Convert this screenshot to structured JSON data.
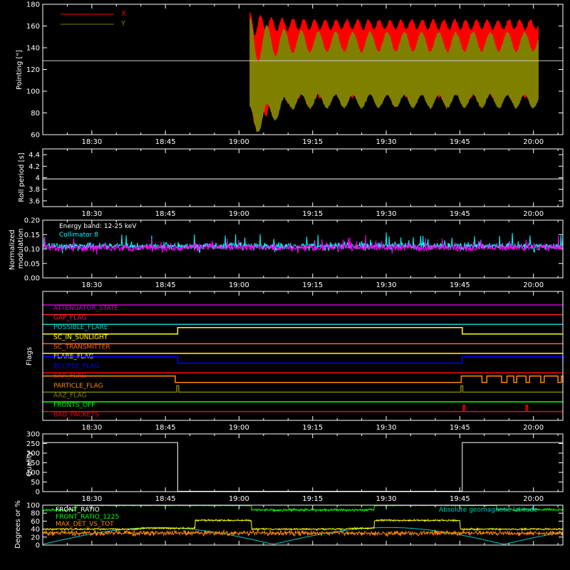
{
  "time_axis": {
    "ticks": [
      "18:30",
      "18:45",
      "19:00",
      "19:15",
      "19:30",
      "19:45",
      "20:00"
    ],
    "tick_minutes": [
      1110,
      1125,
      1140,
      1155,
      1170,
      1185,
      1200
    ],
    "range_minutes": [
      1100,
      1206
    ],
    "minor_step": 5
  },
  "chart_data": [
    {
      "type": "area",
      "id": "pointing",
      "ylabel": "Pointing [\"]",
      "ylim": [
        60,
        180
      ],
      "yticks": [
        60,
        80,
        100,
        120,
        140,
        160,
        180
      ],
      "reference_line": 128,
      "data_span_minutes": [
        1142.2,
        1201
      ],
      "series": [
        {
          "name": "X",
          "color": "#ff0000",
          "upper_mean": 161,
          "upper_amp": 4.5,
          "lower_mean": 100,
          "lower_amp": 6,
          "period_minutes": 2.2
        },
        {
          "name": "Y",
          "color": "#808000",
          "upper_mean": 145,
          "upper_amp": 9,
          "lower_mean": 91,
          "lower_amp": 6,
          "period_minutes": 3.5
        }
      ]
    },
    {
      "type": "line",
      "id": "roll",
      "ylabel": "Roll period [s]",
      "ylim": [
        3.5,
        4.5
      ],
      "yticks": [
        3.6,
        3.8,
        4.0,
        4.2,
        4.4
      ],
      "value": 3.98,
      "color": "#ffffff"
    },
    {
      "type": "line",
      "id": "modulation",
      "ylabel": "Normalized modulation",
      "ylim": [
        0,
        0.2
      ],
      "yticks": [
        "0.00",
        "0.05",
        "0.10",
        "0.15",
        "0.20"
      ],
      "annotation": "Energy band: 12-25 keV",
      "series": [
        {
          "name": "Collimator 8",
          "color": "#00ffff",
          "mean": 0.11
        },
        {
          "name": "",
          "color": "#ff00ff",
          "mean": 0.105
        }
      ]
    },
    {
      "type": "line",
      "id": "flags",
      "ylabel": "Flags",
      "flags": [
        {
          "name": "ATTENUATOR_STATE",
          "color": "#cc00cc",
          "high_spans": []
        },
        {
          "name": "GAP_FLAG",
          "color": "#ff2020",
          "high_spans": []
        },
        {
          "name": "POSSIBLE_FLARE",
          "color": "#00d0d0",
          "high_spans": []
        },
        {
          "name": "SC_IN_SUNLIGHT",
          "color": "#ffff00",
          "high_spans": [
            [
              1127.5,
              1185.5
            ]
          ]
        },
        {
          "name": "SC_TRANSMITTER",
          "color": "#ff6600",
          "high_spans": []
        },
        {
          "name": "FLARE_FLAG",
          "color": "#ffff00",
          "high_spans": []
        },
        {
          "name": "ECLIPSE_FLAG",
          "color": "#0000ff",
          "high_spans": [
            [
              1100,
              1127.5
            ],
            [
              1185.5,
              1206
            ]
          ]
        },
        {
          "name": "SAA_FLAG",
          "color": "#ff0000",
          "high_spans": []
        },
        {
          "name": "PARTICLE_FLAG",
          "color": "#ff8800",
          "high_spans": [
            [
              1100,
              1127
            ],
            [
              1185.3,
              1189.5
            ],
            [
              1190.5,
              1193.5
            ],
            [
              1194.6,
              1196
            ],
            [
              1196.6,
              1198.5
            ],
            [
              1199.2,
              1201.5
            ],
            [
              1202.2,
              1205
            ],
            [
              1205.7,
              1206
            ]
          ]
        },
        {
          "name": "AAZ_FLAG",
          "color": "#808000",
          "high_spans": [
            [
              1127.3,
              1127.7
            ],
            [
              1185.2,
              1185.6
            ]
          ]
        },
        {
          "name": "FRONTS_OFF",
          "color": "#00ff00",
          "high_spans": []
        },
        {
          "name": "BAD_PACKETS",
          "color": "#ff0000",
          "high_spans": [
            [
              1185.7,
              1186
            ],
            [
              1198.5,
              1198.8
            ]
          ]
        }
      ]
    },
    {
      "type": "line",
      "id": "quality",
      "ylabel": "Quality",
      "ylim": [
        0,
        300
      ],
      "yticks": [
        0,
        50,
        100,
        150,
        200,
        250,
        300
      ],
      "color": "#ffffff",
      "high_value": 255,
      "high_spans": [
        [
          1100,
          1127.5
        ],
        [
          1185.5,
          1206
        ]
      ]
    },
    {
      "type": "line",
      "id": "ratios",
      "ylabel": "Degrees or %",
      "ylim": [
        0,
        100
      ],
      "yticks": [
        0,
        20,
        40,
        60,
        80,
        100
      ],
      "series": [
        {
          "name": "FRONT_RATIO",
          "color": "#ffffff"
        },
        {
          "name": "FRONT_RATIO_1225",
          "color": "#00ff00",
          "levels": [
            [
              1100,
              1106.5,
              88
            ],
            [
              1106.5,
              1142.5,
              99
            ],
            [
              1142.5,
              1167.5,
              88
            ],
            [
              1167.5,
              1192.5,
              99
            ],
            [
              1192.5,
              1206,
              89
            ]
          ]
        },
        {
          "name": "MAX_DET_VS_TOT",
          "color": "#ff8800",
          "mean": 30
        },
        {
          "name": "",
          "color": "#ffff00",
          "levels": [
            [
              1100,
              1120,
              40
            ],
            [
              1120,
              1131,
              42
            ],
            [
              1131,
              1142.5,
              62
            ],
            [
              1142.5,
              1162,
              40
            ],
            [
              1162,
              1167.5,
              42
            ],
            [
              1167.5,
              1185,
              62
            ],
            [
              1185,
              1206,
              40
            ]
          ]
        },
        {
          "name": "Absolute geomagnetic latitude",
          "color": "#00cccc"
        }
      ]
    }
  ]
}
